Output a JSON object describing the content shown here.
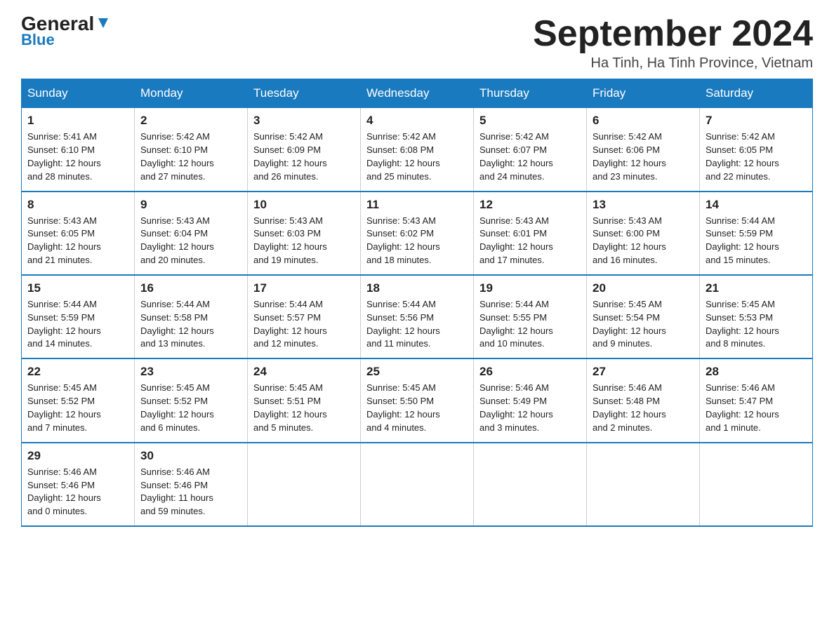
{
  "logo": {
    "general": "General",
    "blue": "Blue"
  },
  "title": "September 2024",
  "location": "Ha Tinh, Ha Tinh Province, Vietnam",
  "headers": [
    "Sunday",
    "Monday",
    "Tuesday",
    "Wednesday",
    "Thursday",
    "Friday",
    "Saturday"
  ],
  "weeks": [
    [
      {
        "day": "1",
        "sunrise": "5:41 AM",
        "sunset": "6:10 PM",
        "daylight": "12 hours and 28 minutes."
      },
      {
        "day": "2",
        "sunrise": "5:42 AM",
        "sunset": "6:10 PM",
        "daylight": "12 hours and 27 minutes."
      },
      {
        "day": "3",
        "sunrise": "5:42 AM",
        "sunset": "6:09 PM",
        "daylight": "12 hours and 26 minutes."
      },
      {
        "day": "4",
        "sunrise": "5:42 AM",
        "sunset": "6:08 PM",
        "daylight": "12 hours and 25 minutes."
      },
      {
        "day": "5",
        "sunrise": "5:42 AM",
        "sunset": "6:07 PM",
        "daylight": "12 hours and 24 minutes."
      },
      {
        "day": "6",
        "sunrise": "5:42 AM",
        "sunset": "6:06 PM",
        "daylight": "12 hours and 23 minutes."
      },
      {
        "day": "7",
        "sunrise": "5:42 AM",
        "sunset": "6:05 PM",
        "daylight": "12 hours and 22 minutes."
      }
    ],
    [
      {
        "day": "8",
        "sunrise": "5:43 AM",
        "sunset": "6:05 PM",
        "daylight": "12 hours and 21 minutes."
      },
      {
        "day": "9",
        "sunrise": "5:43 AM",
        "sunset": "6:04 PM",
        "daylight": "12 hours and 20 minutes."
      },
      {
        "day": "10",
        "sunrise": "5:43 AM",
        "sunset": "6:03 PM",
        "daylight": "12 hours and 19 minutes."
      },
      {
        "day": "11",
        "sunrise": "5:43 AM",
        "sunset": "6:02 PM",
        "daylight": "12 hours and 18 minutes."
      },
      {
        "day": "12",
        "sunrise": "5:43 AM",
        "sunset": "6:01 PM",
        "daylight": "12 hours and 17 minutes."
      },
      {
        "day": "13",
        "sunrise": "5:43 AM",
        "sunset": "6:00 PM",
        "daylight": "12 hours and 16 minutes."
      },
      {
        "day": "14",
        "sunrise": "5:44 AM",
        "sunset": "5:59 PM",
        "daylight": "12 hours and 15 minutes."
      }
    ],
    [
      {
        "day": "15",
        "sunrise": "5:44 AM",
        "sunset": "5:59 PM",
        "daylight": "12 hours and 14 minutes."
      },
      {
        "day": "16",
        "sunrise": "5:44 AM",
        "sunset": "5:58 PM",
        "daylight": "12 hours and 13 minutes."
      },
      {
        "day": "17",
        "sunrise": "5:44 AM",
        "sunset": "5:57 PM",
        "daylight": "12 hours and 12 minutes."
      },
      {
        "day": "18",
        "sunrise": "5:44 AM",
        "sunset": "5:56 PM",
        "daylight": "12 hours and 11 minutes."
      },
      {
        "day": "19",
        "sunrise": "5:44 AM",
        "sunset": "5:55 PM",
        "daylight": "12 hours and 10 minutes."
      },
      {
        "day": "20",
        "sunrise": "5:45 AM",
        "sunset": "5:54 PM",
        "daylight": "12 hours and 9 minutes."
      },
      {
        "day": "21",
        "sunrise": "5:45 AM",
        "sunset": "5:53 PM",
        "daylight": "12 hours and 8 minutes."
      }
    ],
    [
      {
        "day": "22",
        "sunrise": "5:45 AM",
        "sunset": "5:52 PM",
        "daylight": "12 hours and 7 minutes."
      },
      {
        "day": "23",
        "sunrise": "5:45 AM",
        "sunset": "5:52 PM",
        "daylight": "12 hours and 6 minutes."
      },
      {
        "day": "24",
        "sunrise": "5:45 AM",
        "sunset": "5:51 PM",
        "daylight": "12 hours and 5 minutes."
      },
      {
        "day": "25",
        "sunrise": "5:45 AM",
        "sunset": "5:50 PM",
        "daylight": "12 hours and 4 minutes."
      },
      {
        "day": "26",
        "sunrise": "5:46 AM",
        "sunset": "5:49 PM",
        "daylight": "12 hours and 3 minutes."
      },
      {
        "day": "27",
        "sunrise": "5:46 AM",
        "sunset": "5:48 PM",
        "daylight": "12 hours and 2 minutes."
      },
      {
        "day": "28",
        "sunrise": "5:46 AM",
        "sunset": "5:47 PM",
        "daylight": "12 hours and 1 minute."
      }
    ],
    [
      {
        "day": "29",
        "sunrise": "5:46 AM",
        "sunset": "5:46 PM",
        "daylight": "12 hours and 0 minutes."
      },
      {
        "day": "30",
        "sunrise": "5:46 AM",
        "sunset": "5:46 PM",
        "daylight": "11 hours and 59 minutes."
      },
      {
        "day": "",
        "sunrise": "",
        "sunset": "",
        "daylight": ""
      },
      {
        "day": "",
        "sunrise": "",
        "sunset": "",
        "daylight": ""
      },
      {
        "day": "",
        "sunrise": "",
        "sunset": "",
        "daylight": ""
      },
      {
        "day": "",
        "sunrise": "",
        "sunset": "",
        "daylight": ""
      },
      {
        "day": "",
        "sunrise": "",
        "sunset": "",
        "daylight": ""
      }
    ]
  ]
}
